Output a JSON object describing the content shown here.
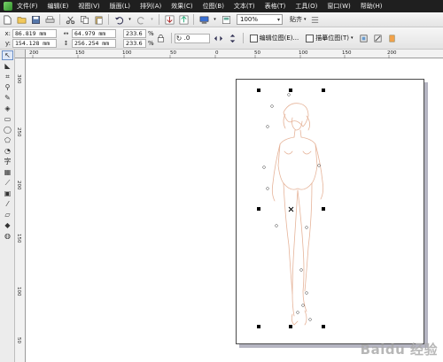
{
  "menu": {
    "items": [
      "文件(F)",
      "编辑(E)",
      "视图(V)",
      "版面(L)",
      "排列(A)",
      "效果(C)",
      "位图(B)",
      "文本(T)",
      "表格(T)",
      "工具(O)",
      "窗口(W)",
      "帮助(H)"
    ]
  },
  "toolbar": {
    "zoom": "100%",
    "snap_label": "贴齐"
  },
  "property_bar": {
    "x_label": "x:",
    "x_value": "86.819 mm",
    "y_label": "y:",
    "y_value": "154.128 mm",
    "width_value": "64.979 mm",
    "height_value": "256.254 mm",
    "scale_x": "233.6",
    "scale_y": "233.6",
    "percent": "%",
    "rotation": ".0",
    "edit_bitmap_label": "编辑位图(E)...",
    "trace_bitmap_label": "描摹位图(T)"
  },
  "ruler": {
    "top_ticks": [
      "200",
      "150",
      "100",
      "50",
      "0",
      "50",
      "100",
      "150",
      "200"
    ],
    "left_ticks": [
      "300",
      "250",
      "200",
      "150",
      "100",
      "50"
    ]
  },
  "watermark": "Baidu 经验",
  "colors": {
    "menubar": "#1f1f1f",
    "sketch_stroke": "#e6b49a",
    "selection_handle": "#000000"
  }
}
